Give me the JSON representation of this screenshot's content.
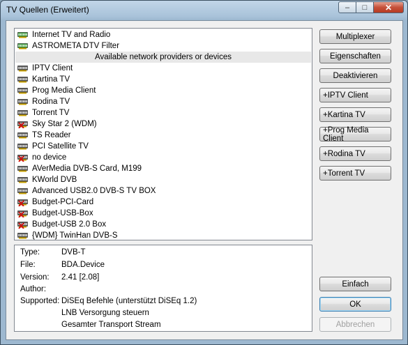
{
  "window": {
    "title": "TV Quellen (Erweitert)"
  },
  "list": {
    "items": [
      {
        "label": "Internet TV and Radio",
        "icon": "green-card-icon"
      },
      {
        "label": "ASTROMETA DTV Filter",
        "icon": "green-card-icon"
      },
      {
        "label": "Available network providers or devices",
        "header": true
      },
      {
        "label": "IPTV Client",
        "icon": "card-icon"
      },
      {
        "label": "Kartina TV",
        "icon": "card-icon"
      },
      {
        "label": "Prog Media Client",
        "icon": "card-icon"
      },
      {
        "label": "Rodina TV",
        "icon": "card-icon"
      },
      {
        "label": "Torrent TV",
        "icon": "card-icon"
      },
      {
        "label": "Sky Star 2 (WDM)",
        "icon": "card-disabled-icon"
      },
      {
        "label": "TS Reader",
        "icon": "card-icon"
      },
      {
        "label": "PCI Satellite TV",
        "icon": "card-icon"
      },
      {
        "label": "no device",
        "icon": "card-disabled-icon"
      },
      {
        "label": "AVerMedia DVB-S Card, M199",
        "icon": "card-icon"
      },
      {
        "label": "KWorld DVB",
        "icon": "card-icon"
      },
      {
        "label": "Advanced USB2.0 DVB-S TV BOX",
        "icon": "card-icon"
      },
      {
        "label": "Budget-PCI-Card",
        "icon": "card-disabled-icon"
      },
      {
        "label": "Budget-USB-Box",
        "icon": "card-disabled-icon"
      },
      {
        "label": "Budget-USB 2.0 Box",
        "icon": "card-disabled-icon"
      },
      {
        "label": "{WDM} TwinHan DVB-S",
        "icon": "card-icon"
      }
    ]
  },
  "info": {
    "type_label": "Type:",
    "type_value": "DVB-T",
    "file_label": "File:",
    "file_value": "BDA.Device",
    "version_label": "Version:",
    "version_value": "2.41 [2.08]",
    "author_label": "Author:",
    "author_value": "",
    "supported_label": "Supported:",
    "supported_values": [
      "DiSEq Befehle (unterstützt DiSEq 1.2)",
      "LNB Versorgung steuern",
      "Gesamter Transport Stream"
    ]
  },
  "buttons": {
    "multiplexer": "Multiplexer",
    "eigenschaften": "Eigenschaften",
    "deaktivieren": "Deaktivieren",
    "iptv": "+IPTV Client",
    "kartina": "+Kartina TV",
    "progmedia": "+Prog Media Client",
    "rodina": "+Rodina TV",
    "torrent": "+Torrent TV",
    "einfach": "Einfach",
    "ok": "OK",
    "abbrechen": "Abbrechen"
  },
  "colors": {
    "card_green": "#3a9a3a",
    "card_gray": "#555555",
    "disabled_x": "#d01010",
    "accent_close": "#c6513a"
  }
}
